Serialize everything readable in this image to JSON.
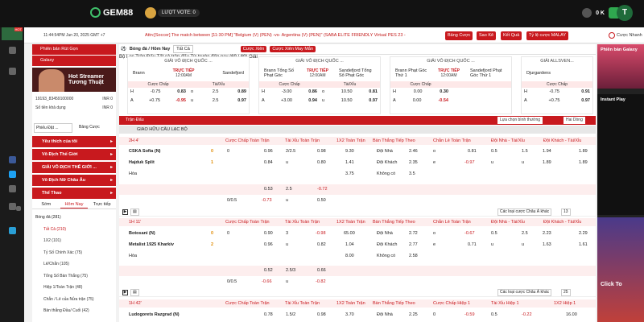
{
  "topbar": {
    "logo": "GEM88",
    "vote_label": "LƯỢT VOTE:",
    "vote_count": "0",
    "balance": "0 K",
    "avatar_letter": "T"
  },
  "leftrail": {
    "hot_badge": "HOT"
  },
  "infobar": {
    "time": "11:44:54PM Jun 20, 2025 GMT +7",
    "ticker": "Attn:[Soccer] The match between [11:30 PM] \"Belgium (V) (PEN) -vs- Argentina (V) (PEN)\" (SABA ELITE FRIENDLY Virtual PES 23 -",
    "buttons": [
      "Bảng Cược",
      "Sao Kê",
      "Kết Quả",
      "Tỷ lệ cược MALAY"
    ],
    "toggle_label": "Cược Nhanh"
  },
  "sidebar": {
    "top_items": [
      "Phiên bản Rút Gọn",
      "Galaxy"
    ],
    "banner_line1": "Hot Streamer",
    "banner_line2": "Tương Thuật",
    "account_id": "19193_83459100000",
    "account_bal": "INR 0",
    "credit_label": "Số tiền khả dụng",
    "credit_value": "INR 0",
    "select1": "Phiếu Đặt ...",
    "select2": "Bảng Cược",
    "menu": [
      "Yêu thích của tôi",
      "Vô Địch Thế Giới",
      "GIẢI VÔ ĐỊCH THẾ GIỚI ...",
      "Vô Địch Nữ Châu Âu",
      "Thể Thao"
    ],
    "tabs": [
      "Sớm",
      "Hôm Nay",
      "Trực tiếp"
    ],
    "sports": [
      {
        "name": "Bóng đá (281)"
      },
      {
        "name": "Tất Cả (210)"
      },
      {
        "name": "1X2 (101)"
      },
      {
        "name": "Tỷ Số Chính Xác (75)"
      },
      {
        "name": "Lẻ/Chẵn (105)"
      },
      {
        "name": "Tổng Số Bàn Thắng (75)"
      },
      {
        "name": "Hiệp 1/Toàn Trận (48)"
      },
      {
        "name": "Chẵn / Lẻ của Nửa trận (75)"
      },
      {
        "name": "Bàn thắng Đầu/ Cuối (42)"
      }
    ]
  },
  "main": {
    "header": {
      "sport": "Bóng đá / Hôm Nay",
      "filter": "Tất Cả",
      "tag1": "Cược Xiên",
      "tag2": "Cược Xiên May Mắn",
      "sort": "Bộ Lọc Trận Đấu",
      "market": "Tất cả trận đấu",
      "sort2": "Từ trước đến nay",
      "pages": "(69 / 69) Giải"
    },
    "cards": [
      {
        "league": "GIẢI VÔ ĐỊCH QUỐC ...",
        "home": "Brann",
        "away": "Sandefjord",
        "live": "TRỰC TIẾP",
        "time": "12:00AM",
        "h1": "-0.75",
        "h1o": "0.83",
        "h2": "2.5",
        "h2o": "0.89",
        "a1": "+0.75",
        "a1o": "-0.95",
        "a2": "2.5",
        "a2o": "0.97"
      },
      {
        "league": "GIẢI VÔ ĐỊCH QUỐC ...",
        "home": "Brann Tổng Số Phạt Góc",
        "away": "Sandefjord Tổng Số Phạt Góc",
        "live": "TRỰC TIẾP",
        "time": "12:00AM",
        "h1": "-3.00",
        "h1o": "0.86",
        "h2": "10.50",
        "h2o": "0.81",
        "a1": "+3.00",
        "a1o": "0.94",
        "a2": "10.50",
        "a2o": "0.97"
      },
      {
        "league": "GIẢI VÔ ĐỊCH QUỐC ...",
        "home": "Brann Phạt Góc Thứ 1",
        "away": "Sandefjord Phạt Góc Thứ 1",
        "live": "TRỰC TIẾP",
        "time": "12:00AM",
        "h1": "0.00",
        "h1o": "0.30",
        "h2": "",
        "h2o": "",
        "a1": "0.00",
        "a1o": "-0.54",
        "a2": "",
        "a2o": ""
      },
      {
        "league": "GIẢI ALLSVEN...",
        "home": "Djurgardens",
        "away": "",
        "live": "",
        "time": "",
        "h1": "-0.75",
        "h1o": "0.91",
        "h2": "",
        "h2o": "",
        "a1": "+0.75",
        "a1o": "0.97",
        "a2": "",
        "a2o": ""
      }
    ],
    "odds_head": [
      "Cược Chấp",
      "Tài/Xỉu"
    ],
    "section_title": "Trận Đấu",
    "section_sort": "Lựa chọn bình thường",
    "section_line": "Hai Dòng",
    "league_name": "GIAO HỮU CÂU LẠC BỘ",
    "columns": [
      "Cược Chấp Toàn Trận",
      "Tài Xỉu Toàn Trận",
      "1X2 Toàn Trận",
      "Bàn Thắng Tiếp Theo",
      "Chẵn Lẻ Toàn Trận",
      "Đội Nhà - Tài/Xỉu",
      "Đội Khách - Tài/Xỉu"
    ],
    "columns3": [
      "Cược Chấp Toàn Trận",
      "Tài Xỉu Toàn Trận",
      "1X2 Toàn Trận",
      "Bàn Thắng Tiếp Theo",
      "Cược Chấp Hiệp 1",
      "Tài Xỉu Hiệp 1",
      "1X2 Hiệp 1"
    ],
    "match1": {
      "time": "2H 4'",
      "home": "CSKA Sofia (N)",
      "away": "Hajduk Split",
      "draw": "Hòa",
      "hs": "0",
      "as": "1",
      "r1": [
        "0",
        "0.96",
        "2/2.5",
        "0.98",
        "9.30",
        "Đội Nhà",
        "2.46",
        "o",
        "0.81",
        "0.5",
        "1.94",
        "1.5",
        "1.89"
      ],
      "r2": [
        "0.84",
        "u",
        "0.80",
        "1.41",
        "Đội Khách",
        "2.35",
        "e",
        "-0.97",
        "u",
        "1.89",
        "u",
        "1.89"
      ],
      "r3": [
        "3.75",
        "Không có",
        "3.5"
      ],
      "r4": [
        "0.53",
        "2.5",
        "-0.72"
      ],
      "r5": [
        "0/0.5",
        "-0.73",
        "u",
        "0.50"
      ]
    },
    "ctrl1": {
      "more": "Các loại cược Châu Á khác",
      "count": "13"
    },
    "match2": {
      "time": "1H 11'",
      "home": "Botosani (N)",
      "away": "Metalist 1925 Kharkiv",
      "draw": "Hòa",
      "hs": "0",
      "as": "2",
      "r1": [
        "0",
        "0.90",
        "3",
        "-0.98",
        "65.00",
        "Đội Nhà",
        "2.72",
        "o",
        "-0.67",
        "0.5",
        "2.23",
        "2.5",
        "2.29"
      ],
      "r2": [
        "0.96",
        "u",
        "0.82",
        "1.04",
        "Đội Khách",
        "2.77",
        "e",
        "0.71",
        "u",
        "1.63",
        "u",
        "1.61"
      ],
      "r3": [
        "8.00",
        "Không có",
        "2.58"
      ],
      "r4": [
        "0.52",
        "2.5/3",
        "0.66"
      ],
      "r5": [
        "0/0.5",
        "-0.66",
        "u",
        "-0.82"
      ]
    },
    "ctrl2": {
      "more": "Các loại cược Châu Á khác",
      "count": "25"
    },
    "match3": {
      "time": "1H 42'",
      "home": "Ludogorets Razgrad (N)",
      "r1": [
        "0.78",
        "1.5/2",
        "0.98",
        "3.70",
        "Đội Nhà",
        "2.25",
        "0",
        "-0.59",
        "0.5",
        "-0.22",
        "16.00"
      ]
    }
  },
  "rightad": {
    "title": "Phiên bản Galaxy",
    "instant": "Instant Play",
    "game": "Click To"
  }
}
